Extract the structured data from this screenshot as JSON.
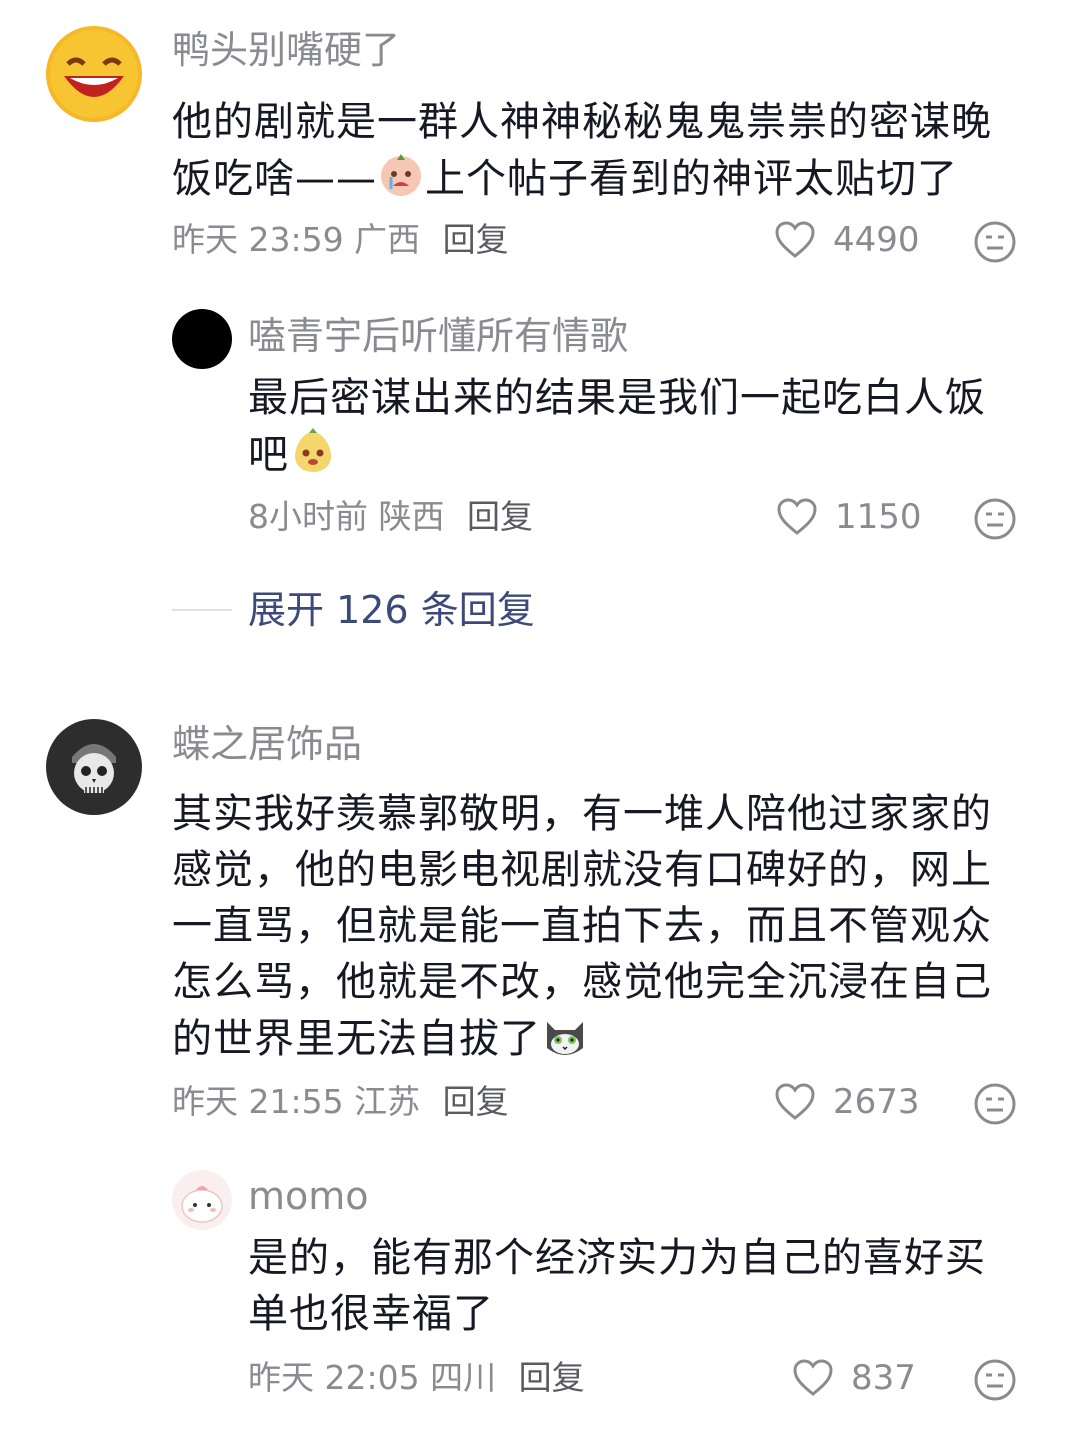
{
  "comments": [
    {
      "username": "鸭头别嘴硬了",
      "text_before_emoji": "他的剧就是一群人神神秘秘鬼鬼祟祟的密谋晚饭吃啥——",
      "text_after_emoji": "上个帖子看到的神评太贴切了",
      "emoji_icon": "crying-face-emoji",
      "meta": "昨天 23:59 广西",
      "reply_label": "回复",
      "likes": "4490",
      "replies": [
        {
          "username": "嗑青宇后听懂所有情歌",
          "text": "最后密谋出来的结果是我们一起吃白人饭吧",
          "emoji_icon": "pear-face-emoji",
          "meta": "8小时前 陕西",
          "reply_label": "回复",
          "likes": "1150"
        }
      ],
      "expand_label": "展开 126 条回复"
    },
    {
      "username": "蝶之居饰品",
      "text": "其实我好羡慕郭敬明，有一堆人陪他过家家的感觉，他的电影电视剧就没有口碑好的，网上一直骂，但就是能一直拍下去，而且不管观众怎么骂，他就是不改，感觉他完全沉浸在自己的世界里无法自拔了",
      "emoji_icon": "cat-face-emoji",
      "meta": "昨天 21:55 江苏",
      "reply_label": "回复",
      "likes": "2673",
      "replies": [
        {
          "username": "momo",
          "text": "是的，能有那个经济实力为自己的喜好买单也很幸福了",
          "meta": "昨天 22:05 四川",
          "reply_label": "回复",
          "likes": "837"
        }
      ]
    }
  ],
  "colors": {
    "username": "#8a8b91",
    "body": "#161823",
    "expand": "#3c4a7a"
  }
}
